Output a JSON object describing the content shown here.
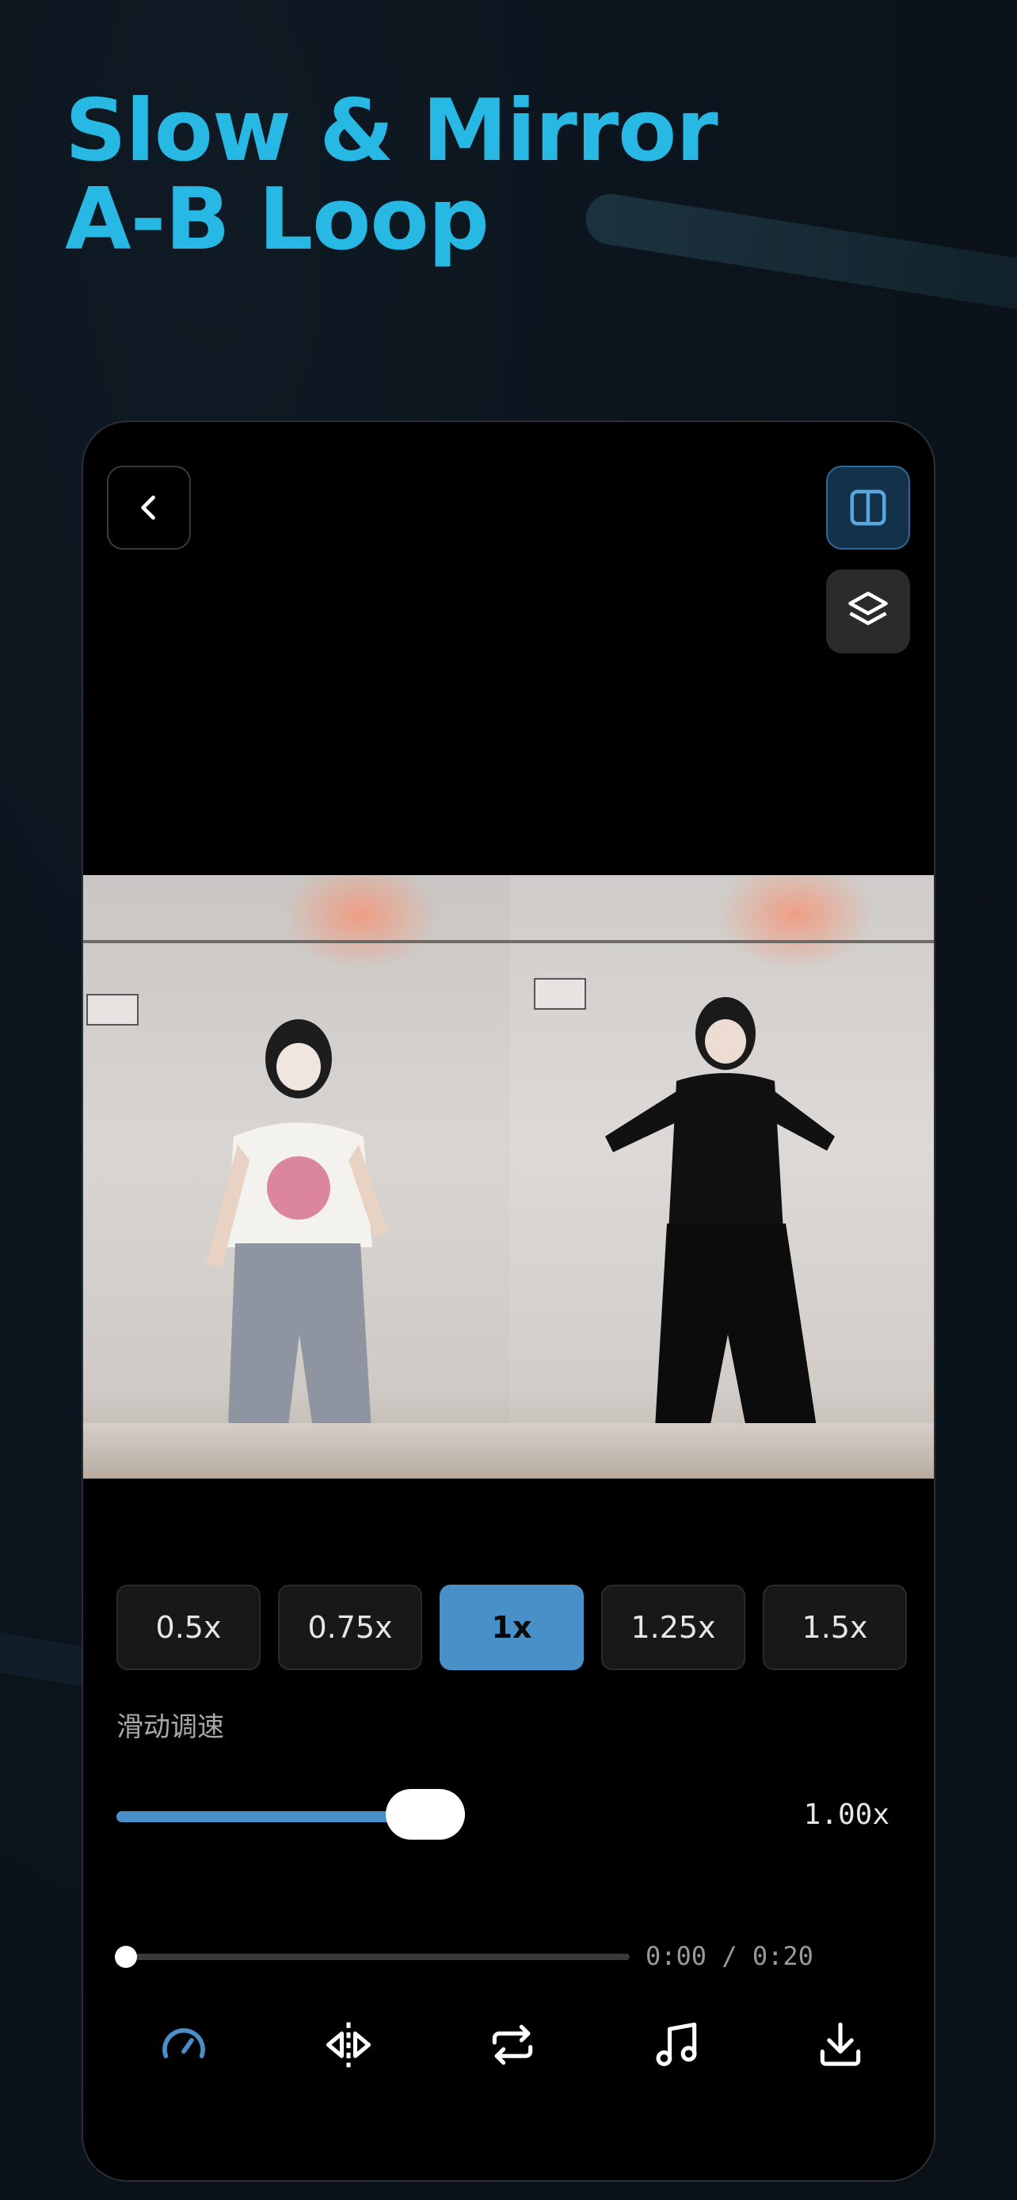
{
  "headline": {
    "line1": "Slow & Mirror",
    "line2": "A-B Loop"
  },
  "top_buttons": {
    "back_icon": "chevron-left-icon",
    "split_icon": "split-view-icon",
    "layers_icon": "layers-icon"
  },
  "video": {
    "play_icon": "play-icon"
  },
  "speed_options": [
    "0.5x",
    "0.75x",
    "1x",
    "1.25x",
    "1.5x"
  ],
  "selected_speed": "1x",
  "slider": {
    "label": "滑动调速",
    "value": "1.00x"
  },
  "playback": {
    "time": "0:00 / 0:20",
    "progress": 0
  },
  "toolbar": [
    "speed-icon",
    "mirror-icon",
    "loop-icon",
    "music-icon",
    "download-icon"
  ],
  "colors": {
    "headline": "#27b8e4",
    "accent": "#4a90c8",
    "background": "#0b131b"
  }
}
